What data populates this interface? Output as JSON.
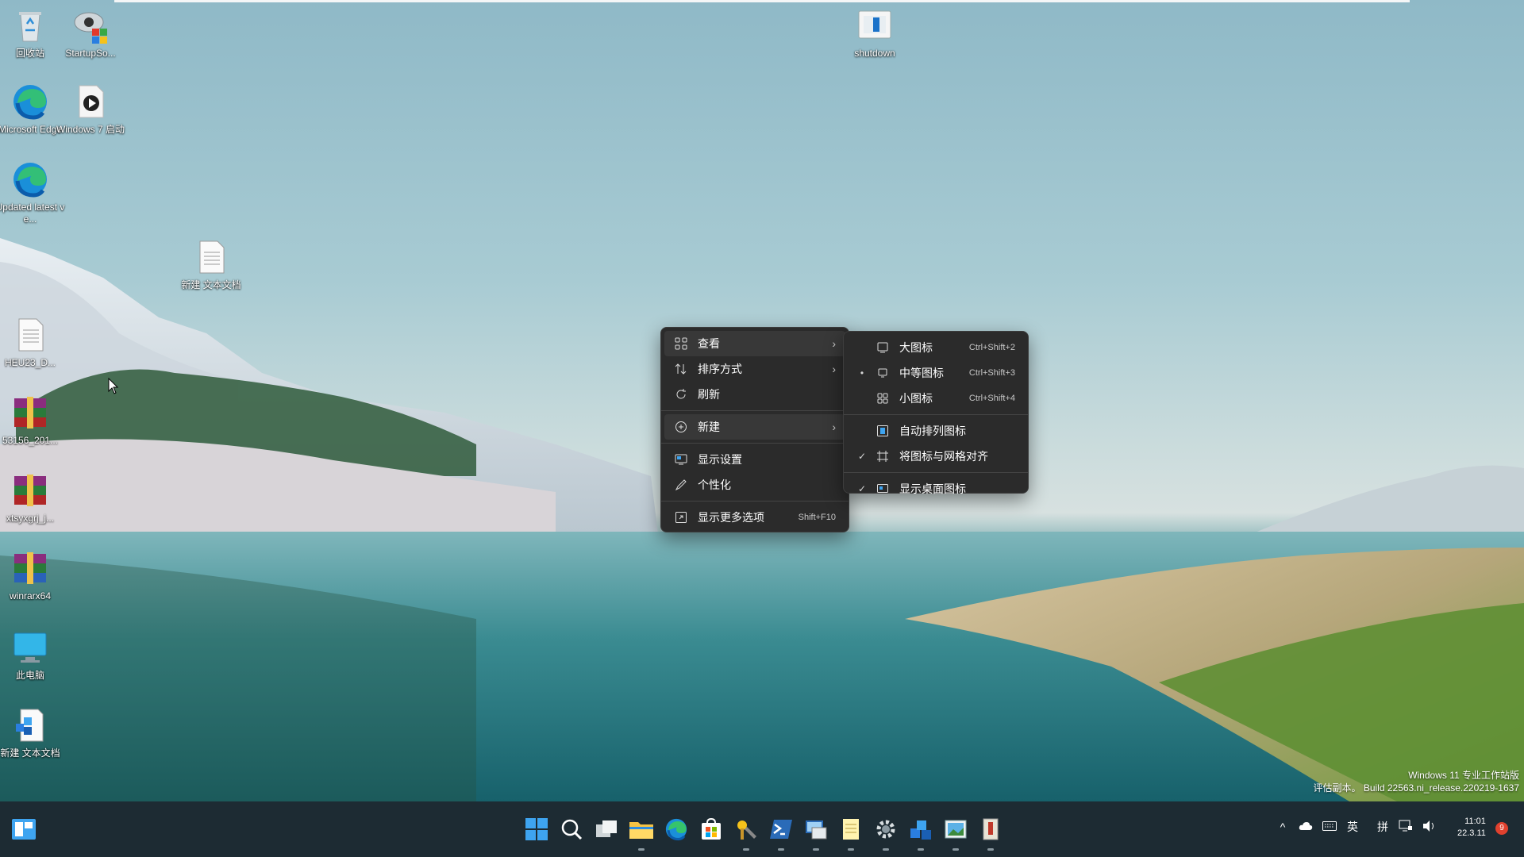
{
  "desktop": {
    "icons": [
      {
        "label": "回收站",
        "icon": "recycle-bin-icon"
      },
      {
        "label": "StartupSo...",
        "icon": "startup-sound-icon"
      },
      {
        "label": "Microsoft Edge",
        "icon": "edge-icon"
      },
      {
        "label": "Windows 7 启动",
        "icon": "media-file-icon"
      },
      {
        "label": "Updated latest ve...",
        "icon": "edge-icon"
      },
      {
        "label": "新建 文本文档",
        "icon": "text-document-icon"
      },
      {
        "label": "HEU23_D...",
        "icon": "text-document-icon"
      },
      {
        "label": "53156_201...",
        "icon": "winrar-archive-icon"
      },
      {
        "label": "xtsyxgrj_j...",
        "icon": "winrar-archive-icon"
      },
      {
        "label": "winrarx64",
        "icon": "winrar-archive-icon"
      },
      {
        "label": "此电脑",
        "icon": "this-pc-icon"
      },
      {
        "label": "新建 文本文档",
        "icon": "text-document-icon"
      },
      {
        "label": "shutdown",
        "icon": "shutdown-shortcut-icon"
      }
    ]
  },
  "context_menu": {
    "items": [
      {
        "label": "查看",
        "icon": "grid-view-icon",
        "submenu": true
      },
      {
        "label": "排序方式",
        "icon": "sort-icon",
        "submenu": true
      },
      {
        "label": "刷新",
        "icon": "refresh-icon"
      },
      {
        "label": "新建",
        "icon": "new-plus-icon",
        "submenu": true
      },
      {
        "label": "显示设置",
        "icon": "display-settings-icon"
      },
      {
        "label": "个性化",
        "icon": "personalize-pen-icon"
      },
      {
        "label": "显示更多选项",
        "icon": "more-options-icon",
        "shortcut": "Shift+F10"
      }
    ]
  },
  "view_submenu": {
    "items": [
      {
        "label": "大图标",
        "shortcut": "Ctrl+Shift+2",
        "mark": ""
      },
      {
        "label": "中等图标",
        "shortcut": "Ctrl+Shift+3",
        "mark": "•"
      },
      {
        "label": "小图标",
        "shortcut": "Ctrl+Shift+4",
        "mark": ""
      },
      {
        "label": "自动排列图标",
        "shortcut": "",
        "mark": ""
      },
      {
        "label": "将图标与网格对齐",
        "shortcut": "",
        "mark": "✓"
      },
      {
        "label": "显示桌面图标",
        "shortcut": "",
        "mark": "✓"
      }
    ]
  },
  "watermark": {
    "line1": "Windows 11 专业工作站版",
    "line2": "评估副本。 Build 22563.ni_release.220219-1637"
  },
  "taskbar": {
    "apps": [
      "start-icon",
      "search-icon",
      "task-view-icon",
      "file-explorer-icon",
      "edge-icon",
      "store-icon",
      "tools-icon",
      "powershell-icon",
      "remote-desktop-icon",
      "notepad-icon",
      "settings-icon",
      "packages-icon",
      "photos-icon",
      "archive-icon"
    ],
    "tray": {
      "ime_lang": "英",
      "ime_mode": "拼"
    },
    "clock": {
      "time": "11:01",
      "date": "22.3.11"
    },
    "notification_count": "9"
  },
  "colors": {
    "menu_bg": "#2b2b2b",
    "taskbar_bg": "#1d2b33",
    "start_blue": "#3ea4f0"
  }
}
